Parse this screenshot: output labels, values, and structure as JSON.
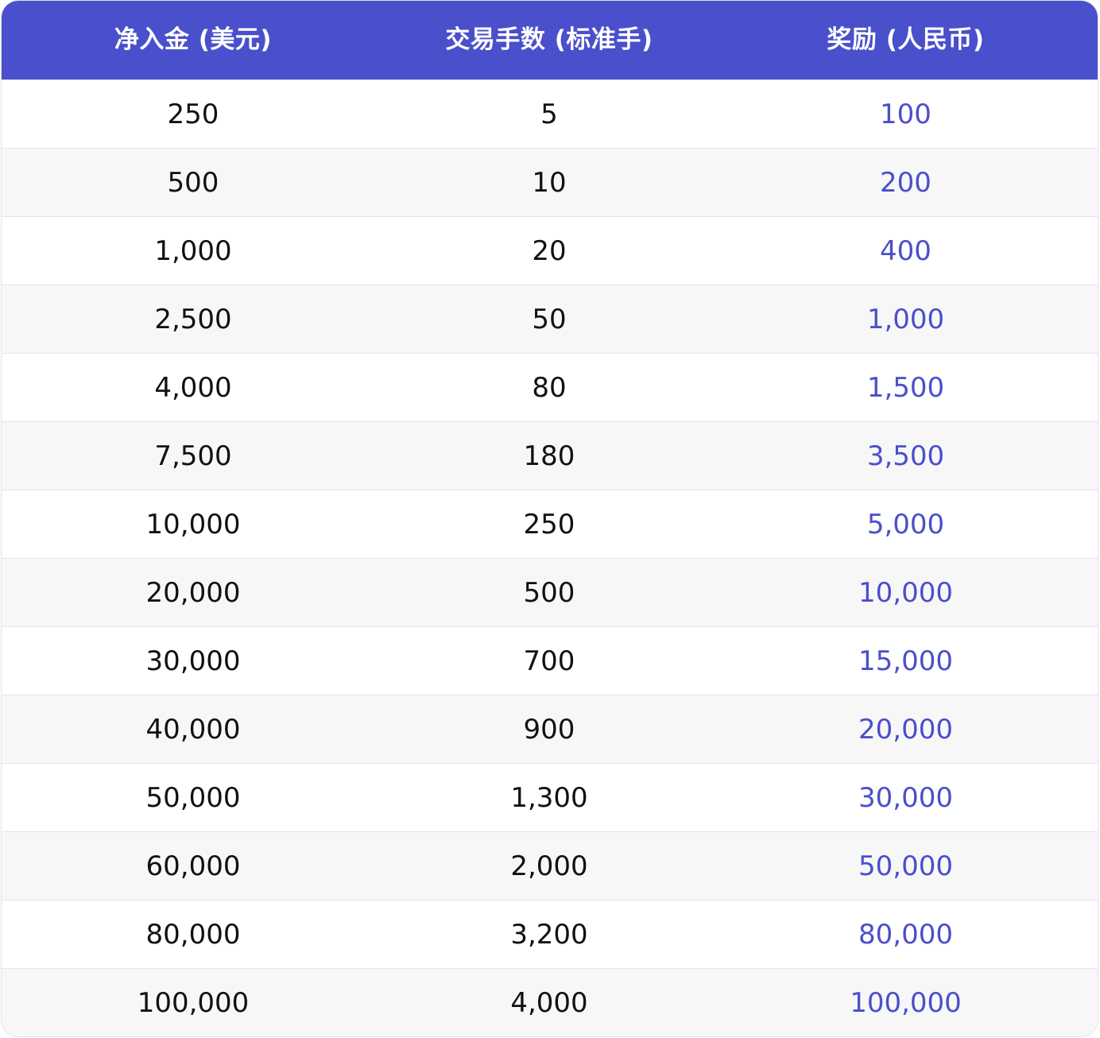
{
  "table": {
    "headers": {
      "deposit": "净入金 (美元)",
      "lots": "交易手数 (标准手)",
      "reward": "奖励 (人民币)"
    },
    "rows": [
      {
        "deposit": "250",
        "lots": "5",
        "reward": "100"
      },
      {
        "deposit": "500",
        "lots": "10",
        "reward": "200"
      },
      {
        "deposit": "1,000",
        "lots": "20",
        "reward": "400"
      },
      {
        "deposit": "2,500",
        "lots": "50",
        "reward": "1,000"
      },
      {
        "deposit": "4,000",
        "lots": "80",
        "reward": "1,500"
      },
      {
        "deposit": "7,500",
        "lots": "180",
        "reward": "3,500"
      },
      {
        "deposit": "10,000",
        "lots": "250",
        "reward": "5,000"
      },
      {
        "deposit": "20,000",
        "lots": "500",
        "reward": "10,000"
      },
      {
        "deposit": "30,000",
        "lots": "700",
        "reward": "15,000"
      },
      {
        "deposit": "40,000",
        "lots": "900",
        "reward": "20,000"
      },
      {
        "deposit": "50,000",
        "lots": "1,300",
        "reward": "30,000"
      },
      {
        "deposit": "60,000",
        "lots": "2,000",
        "reward": "50,000"
      },
      {
        "deposit": "80,000",
        "lots": "3,200",
        "reward": "80,000"
      },
      {
        "deposit": "100,000",
        "lots": "4,000",
        "reward": "100,000"
      }
    ]
  },
  "colors": {
    "header_bg": "#4a4fcb",
    "header_text": "#ffffff",
    "reward_text": "#4a4fcb",
    "body_text": "#111111",
    "alt_row_bg": "#f7f7f8",
    "border": "#e1e5f0"
  }
}
